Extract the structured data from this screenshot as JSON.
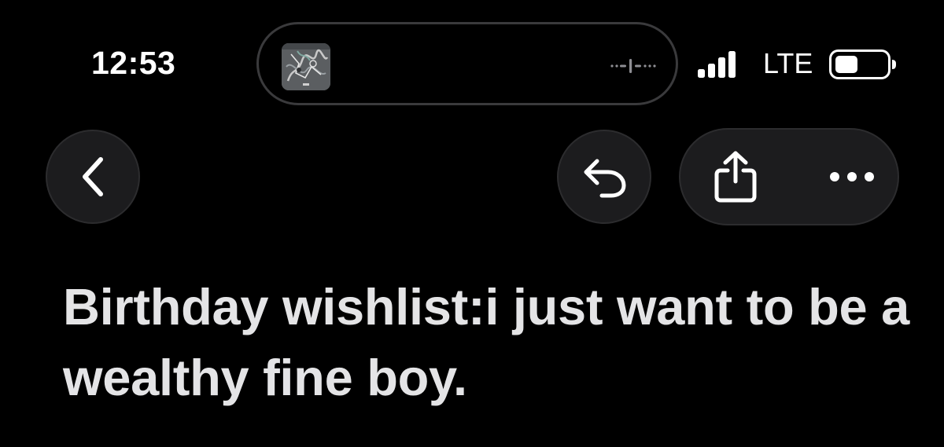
{
  "status_bar": {
    "time": "12:53",
    "network": "LTE",
    "signal_bars_active": 4,
    "battery_fill_fraction": 0.4
  },
  "dynamic_island": {
    "artwork_icon": "album-art-thumbnail",
    "activity_icon": "audio-waveform-icon"
  },
  "nav": {
    "back_icon": "chevron-left-icon",
    "reply_icon": "reply-arrow-icon",
    "share_icon": "share-icon",
    "more_icon": "ellipsis-icon"
  },
  "content": {
    "text": "Birthday wishlist:i just want to be a wealthy fine boy."
  },
  "colors": {
    "background": "#000000",
    "control_fill": "#1c1c1e",
    "text_primary": "#e4e4e6",
    "island_border": "#3a3a3c"
  }
}
